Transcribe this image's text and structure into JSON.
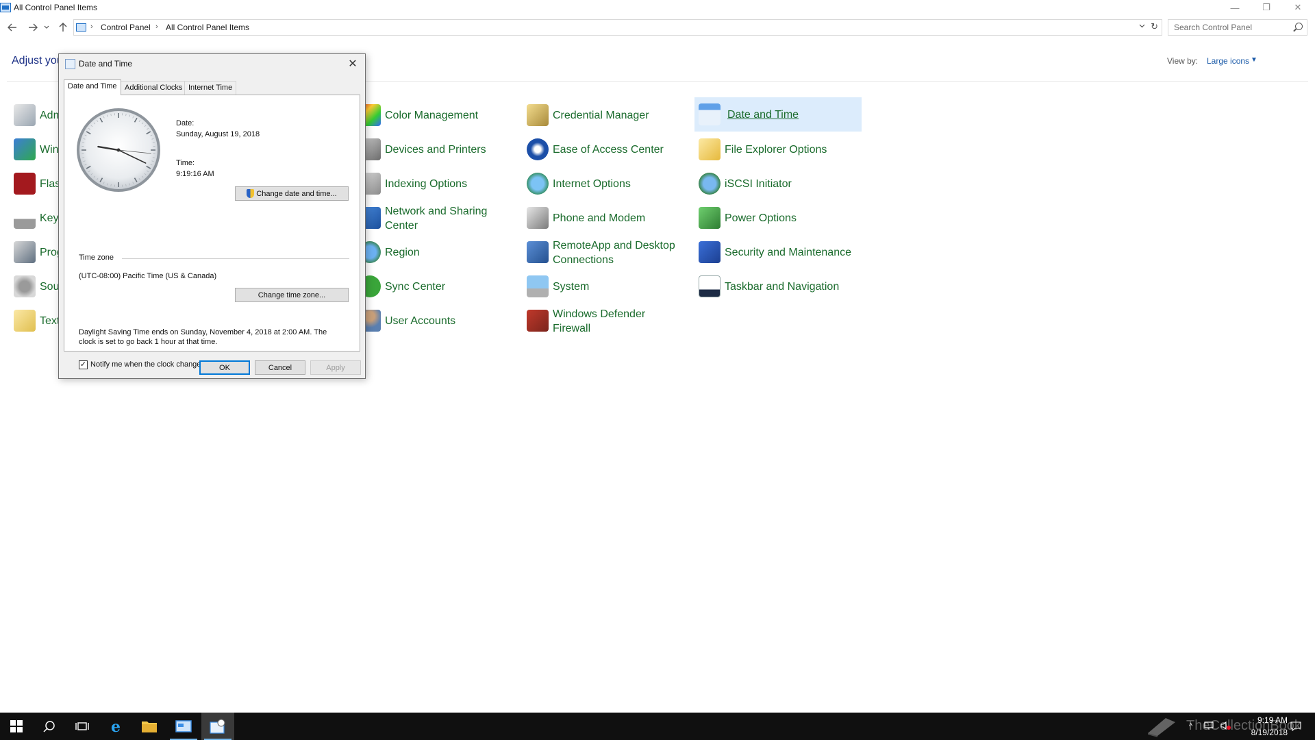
{
  "window": {
    "title": "All Control Panel Items",
    "minimize_glyph": "—",
    "restore_glyph": "❐",
    "close_glyph": "✕"
  },
  "address": {
    "crumbs": [
      "Control Panel",
      "All Control Panel Items"
    ],
    "search_placeholder": "Search Control Panel"
  },
  "page": {
    "heading": "Adjust your computer's settings",
    "view_by_label": "View by:",
    "view_by_value": "Large icons"
  },
  "items": {
    "administrative_tools": "Administrative Tools",
    "defender": "Windows Defender",
    "flash": "Flash Player",
    "keyboard": "Keyboard",
    "programs": "Programs and Features",
    "sound": "Sound",
    "text_to_speech": "Text to Speech",
    "color_management": "Color Management",
    "devices_printers": "Devices and Printers",
    "indexing": "Indexing Options",
    "network": "Network and Sharing Center",
    "region": "Region",
    "sync": "Sync Center",
    "user_accounts": "User Accounts",
    "credential_manager": "Credential Manager",
    "ease_of_access": "Ease of Access Center",
    "internet_options": "Internet Options",
    "phone_modem": "Phone and Modem",
    "remoteapp": "RemoteApp and Desktop Connections",
    "system": "System",
    "defender_firewall": "Windows Defender Firewall",
    "date_time": "Date and Time",
    "file_explorer": "File Explorer Options",
    "iscsi": "iSCSI Initiator",
    "power": "Power Options",
    "security": "Security and Maintenance",
    "taskbar_nav": "Taskbar and Navigation"
  },
  "dialog": {
    "title": "Date and Time",
    "close_glyph": "✕",
    "tabs": [
      "Date and Time",
      "Additional Clocks",
      "Internet Time"
    ],
    "date_label": "Date:",
    "date_value": "Sunday, August 19, 2018",
    "time_label": "Time:",
    "time_value": "9:19:16 AM",
    "change_datetime_button": "Change date and time...",
    "timezone_label": "Time zone",
    "timezone_value": "(UTC-08:00) Pacific Time (US & Canada)",
    "change_timezone_button": "Change time zone...",
    "dst_line1": "Daylight Saving Time ends on Sunday, November 4, 2018 at 2:00 AM. The",
    "dst_line2": "clock is set to go back 1 hour at that time.",
    "notify_checked": true,
    "notify_check_glyph": "✓",
    "notify_label": "Notify me when the clock changes",
    "ok": "OK",
    "cancel": "Cancel",
    "apply": "Apply",
    "clock_hour": 9,
    "clock_minute": 19,
    "clock_second": 16
  },
  "taskbar": {
    "time": "9:19 AM",
    "date": "8/19/2018",
    "watermark": "TheCollectionBook"
  },
  "colors": {
    "link_green": "#1a6b2c",
    "selected_bg": "#dcecfc",
    "accent": "#0078d7",
    "taskbar": "#101010"
  }
}
